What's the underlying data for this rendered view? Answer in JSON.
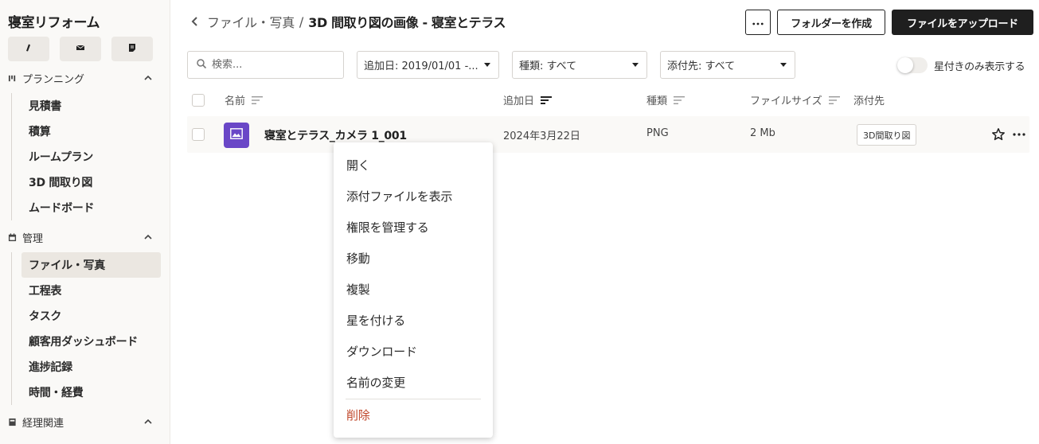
{
  "sidebar": {
    "project_title": "寝室リフォーム",
    "quick_buttons": [
      {
        "icon": "info-icon"
      },
      {
        "icon": "mail-icon"
      },
      {
        "icon": "note-icon"
      }
    ],
    "sections": [
      {
        "title": "プランニング",
        "icon": "planning-icon",
        "items": [
          {
            "label": "見積書"
          },
          {
            "label": "積算"
          },
          {
            "label": "ルームプラン"
          },
          {
            "label": "3D 間取り図"
          },
          {
            "label": "ムードボード"
          }
        ]
      },
      {
        "title": "管理",
        "icon": "calendar-icon",
        "items": [
          {
            "label": "ファイル・写真",
            "active": true
          },
          {
            "label": "工程表"
          },
          {
            "label": "タスク"
          },
          {
            "label": "顧客用ダッシュボード"
          },
          {
            "label": "進捗記録"
          },
          {
            "label": "時間・経費"
          }
        ]
      },
      {
        "title": "経理関連",
        "icon": "ledger-icon",
        "items": []
      }
    ]
  },
  "header": {
    "breadcrumb_parent": "ファイル・写真",
    "breadcrumb_sep": "/",
    "breadcrumb_current": "3D 間取り図の画像 - 寝室とテラス",
    "more_label": "…",
    "create_folder_label": "フォルダーを作成",
    "upload_label": "ファイルをアップロード"
  },
  "filters": {
    "search_placeholder": "検索...",
    "date_filter": "追加日: 2019/01/01 -...",
    "type_filter": "種類: すべて",
    "attach_filter": "添付先: すべて",
    "starred_toggle_label": "星付きのみ表示する",
    "starred_only": false
  },
  "table": {
    "columns": {
      "name": "名前",
      "added": "追加日",
      "type": "種類",
      "size": "ファイルサイズ",
      "attached": "添付先"
    },
    "rows": [
      {
        "name": "寝室とテラス_カメラ 1_001",
        "added": "2024年3月22日",
        "type": "PNG",
        "size": "2 Mb",
        "attached": "3D間取り図",
        "icon": "image-icon",
        "thumb_color": "#6a47c7"
      }
    ]
  },
  "context_menu": {
    "items": [
      "開く",
      "添付ファイルを表示",
      "権限を管理する",
      "移動",
      "複製",
      "星を付ける",
      "ダウンロード",
      "名前の変更"
    ],
    "danger_item": "削除",
    "danger_color": "#c0482b"
  }
}
